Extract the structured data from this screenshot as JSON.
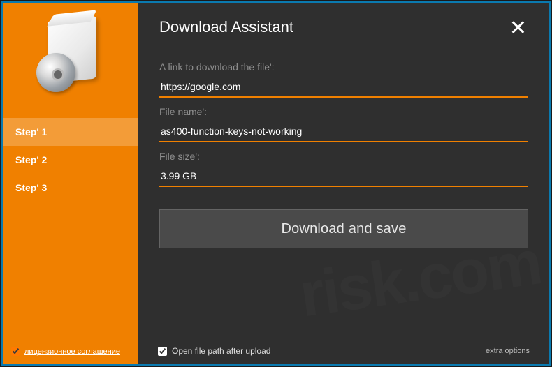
{
  "header": {
    "title": "Download Assistant"
  },
  "sidebar": {
    "steps": [
      {
        "label": "Step' 1",
        "active": true
      },
      {
        "label": "Step' 2",
        "active": false
      },
      {
        "label": "Step' 3",
        "active": false
      }
    ],
    "license": {
      "label": "лицензионное соглашение",
      "checked": true
    }
  },
  "form": {
    "link_label": "A link to download the file':",
    "link_value": "https://google.com",
    "filename_label": "File name':",
    "filename_value": "as400-function-keys-not-working",
    "filesize_label": "File size':",
    "filesize_value": "3.99 GB",
    "download_button": "Download and save"
  },
  "footer": {
    "open_path_label": "Open file path after upload",
    "open_path_checked": true,
    "extra": "extra options"
  }
}
